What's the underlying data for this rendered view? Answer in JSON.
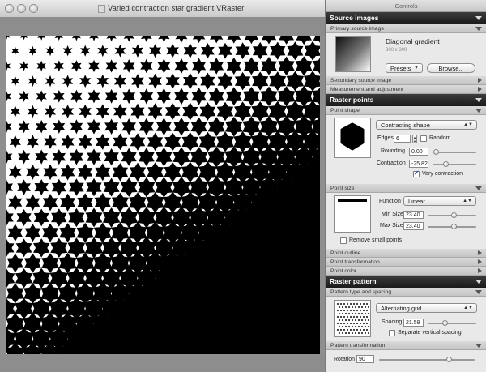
{
  "window": {
    "title": "Varied contraction star gradient.VRaster"
  },
  "panel": {
    "title": "Controls",
    "source_images": {
      "header": "Source images",
      "primary_label": "Primary source image",
      "image_name": "Diagonal gradient",
      "image_size": "300 x 300",
      "presets_label": "Presets",
      "browse_label": "Browse...",
      "secondary_label": "Secondary source image",
      "measurement_label": "Measurement and adjustment"
    },
    "raster_points": {
      "header": "Raster points",
      "point_shape_label": "Point shape",
      "shape_type": "Contracting shape",
      "edges_label": "Edges",
      "edges_value": "6",
      "random_label": "Random",
      "random_checked": false,
      "rounding_label": "Rounding",
      "rounding_value": "0.00",
      "rounding_level": 0.02,
      "contraction_label": "Contraction",
      "contraction_value": "-25.82",
      "contraction_level": 0.28,
      "vary_label": "Vary contraction",
      "vary_checked": true,
      "point_size_label": "Point size",
      "function_label": "Function",
      "function_value": "Linear",
      "min_size_label": "Min Size",
      "min_size_value": "23.40",
      "min_size_level": 0.55,
      "max_size_label": "Max Size",
      "max_size_value": "23.40",
      "max_size_level": 0.55,
      "remove_small_label": "Remove small points",
      "remove_small_checked": false,
      "outline_label": "Point outline",
      "transformation_label": "Point transformation",
      "color_label": "Point color"
    },
    "raster_pattern": {
      "header": "Raster pattern",
      "type_spacing_label": "Pattern type and spacing",
      "grid_type": "Alternating grid",
      "spacing_label": "Spacing",
      "spacing_value": "21.59",
      "spacing_level": 0.35,
      "separate_label": "Separate vertical spacing",
      "separate_checked": false,
      "pattern_transformation_label": "Pattern transformation",
      "rotation_label": "Rotation",
      "rotation_value": "90",
      "rotation_level": 0.75
    }
  },
  "icons": {
    "window_controls": [
      "close-light",
      "minimize-light",
      "zoom-light"
    ],
    "document_icon": "document-icon",
    "disclosure": "disclosure-triangle-icon"
  },
  "colors": {
    "section_header": "#1f1f1f",
    "panel_bg": "#e9e9e9",
    "doc_bg": "#8f8f8f",
    "raster_ink": "#000000"
  }
}
